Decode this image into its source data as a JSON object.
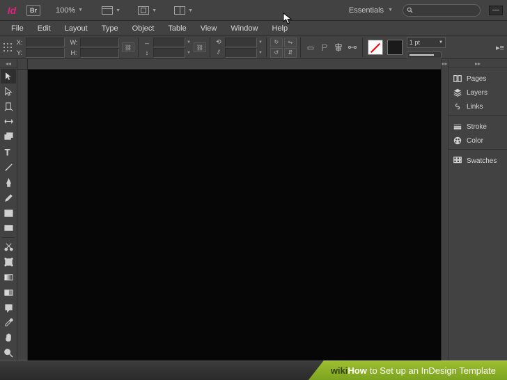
{
  "appbar": {
    "logo": "Id",
    "bridge": "Br",
    "zoom": "100%",
    "workspace": "Essentials",
    "search_placeholder": ""
  },
  "menu": [
    "File",
    "Edit",
    "Layout",
    "Type",
    "Object",
    "Table",
    "View",
    "Window",
    "Help"
  ],
  "control": {
    "x_label": "X:",
    "y_label": "Y:",
    "w_label": "W:",
    "h_label": "H:",
    "stroke_weight": "1 pt"
  },
  "panels": {
    "group1": [
      {
        "icon": "pages",
        "label": "Pages"
      },
      {
        "icon": "layers",
        "label": "Layers"
      },
      {
        "icon": "links",
        "label": "Links"
      }
    ],
    "group2": [
      {
        "icon": "stroke",
        "label": "Stroke"
      },
      {
        "icon": "color",
        "label": "Color"
      }
    ],
    "group3": [
      {
        "icon": "swatches",
        "label": "Swatches"
      }
    ]
  },
  "caption": {
    "brand1": "wiki",
    "brand2": "How",
    "title": "to Set up an InDesign Template"
  }
}
